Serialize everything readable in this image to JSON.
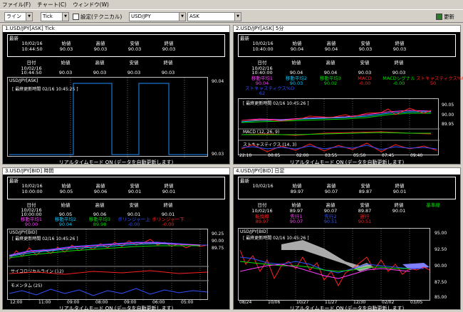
{
  "menu": {
    "file": "ファイル(F)",
    "chart": "チャート(C)",
    "window": "ウィンドウ(W)"
  },
  "toolbar": {
    "line_type": "ライン",
    "period": "Tick",
    "settings": "設定(テクニカル)",
    "symbol": "USD/JPY",
    "side": "ASK",
    "refresh": "更新"
  },
  "realtime_label": "リアルタイムモード ON (データを自動更新します)",
  "latest_label": "最新",
  "panels": [
    {
      "title": "1.USD/JPY[ASK] Tick",
      "q_head": [
        "日付",
        "始値",
        "高値",
        "安値",
        "終値"
      ],
      "q_vals": [
        "10/02/16",
        "90.03",
        "90.03",
        "90.03",
        "90.03"
      ],
      "q_time": "10:44:50",
      "c_head": [
        "日付",
        "始値",
        "高値",
        "安値",
        "終値"
      ],
      "c_vals": [
        "10/02/16",
        "90.03",
        "90.03",
        "90.03",
        "90.03"
      ],
      "c_time": "10:44:50",
      "chart_title": "USD/JPY[ASK]",
      "chart_time": "[ 最終更新時間 02/16 10:45:25 ]",
      "y_labels": [
        "90.04",
        "90.03"
      ]
    },
    {
      "title": "2.USD/JPY[ASK] 5分",
      "q_head": [
        "日付",
        "始値",
        "高値",
        "安値",
        "終値"
      ],
      "q_vals": [
        "10/02/16",
        "90.04",
        "90.04",
        "90.03",
        "90.03"
      ],
      "q_time": "10:40:00",
      "c_head": [
        "日付",
        "始値",
        "高値",
        "安値",
        "終値"
      ],
      "c_vals": [
        "10/02/16",
        "90.04",
        "90.04",
        "90.03",
        "90.03"
      ],
      "c_time": "10:40:00",
      "ind_head": [
        "移動平均1",
        "移動平均2",
        "移動平均3",
        "MACD",
        "MACDシグナル",
        "ストキャスティクス%K"
      ],
      "ind_vals": [
        "90.04",
        "90.03",
        "90.02",
        "-0.00",
        "-0.00",
        "50"
      ],
      "ind_extra": "ストキャスティクス%D",
      "ind_extra_val": "62",
      "chart_time": "[ 最終更新時間 02/16 10:45:26 ]",
      "y_labels": [
        "90.05",
        "90.00",
        "89.95"
      ],
      "sub1": "MACD (12, 26, 9)",
      "sub2": "ストキャスティクス (14, 3)",
      "x_labels": [
        "22:10",
        "00:05",
        "02:00",
        "03:55",
        "05:50",
        "07:45",
        "09:40"
      ]
    },
    {
      "title": "3.USD/JPY[BID] 時間",
      "q_head": [
        "日付",
        "始値",
        "高値",
        "安値",
        "終値"
      ],
      "q_vals": [
        "10/02/16",
        "90.05",
        "90.06",
        "90.01",
        "90.01"
      ],
      "q_time": "10:00:00",
      "c_head": [
        "日付",
        "始値",
        "高値",
        "安値",
        "終値"
      ],
      "c_vals": [
        "10/02/16",
        "90.05",
        "90.06",
        "90.01",
        "90.01"
      ],
      "c_time": "10:00:00",
      "ind_head": [
        "移動平均1",
        "移動平均2",
        "移動平均3",
        "ボリンジャー上",
        "ボリンジャー下"
      ],
      "ind_vals": [
        "90.00",
        "90.04",
        "89.98",
        "-0.00",
        "-0.00"
      ],
      "chart_title": "USD/JPY[BID]",
      "chart_time": "[ 最終更新時間 02/16 10:45:26 ]",
      "y_labels": [
        "90.25",
        "90.00",
        "89.75"
      ],
      "sub1": "サイコロジカルライン (12)",
      "sub2": "モメンタム (25)",
      "x_labels": [
        "12:00",
        "11:00",
        "09:00",
        "08:00",
        "09:00",
        "06:00",
        "05:00"
      ]
    },
    {
      "title": "4.USD/JPY[BID] 日足",
      "q_head": [
        "日付",
        "始値",
        "高値",
        "安値",
        "終値"
      ],
      "q_vals": [
        "10/02/16",
        "89.97",
        "90.07",
        "89.87",
        "90.01"
      ],
      "c_head": [
        "日付",
        "始値",
        "高値",
        "安値",
        "終値",
        "基準線"
      ],
      "c_vals": [
        "10/02/16",
        "89.97",
        "90.07",
        "89.87",
        "90.01"
      ],
      "ind_head": [
        "転換線",
        "先行1",
        "先行2",
        "遅行",
        "基準線"
      ],
      "ind_vals": [
        "89.97",
        "90.07",
        "90.51",
        "90.51"
      ],
      "chart_title": "USD/JPY[BID]",
      "chart_time": "[ 最終更新時間 02/16 10:45:26 ]",
      "y_labels": [
        "95.00",
        "92.50",
        "90.00",
        "87.50",
        "85.00"
      ],
      "x_labels": [
        "08/24",
        "10/06",
        "10/27",
        "11/27",
        "12/30",
        "02/02",
        "03/05"
      ]
    }
  ],
  "colors": {
    "ma1": "#ff3fff",
    "ma2": "#00c8ff",
    "ma3": "#00e000",
    "red": "#ff2020",
    "blue": "#3050ff"
  }
}
